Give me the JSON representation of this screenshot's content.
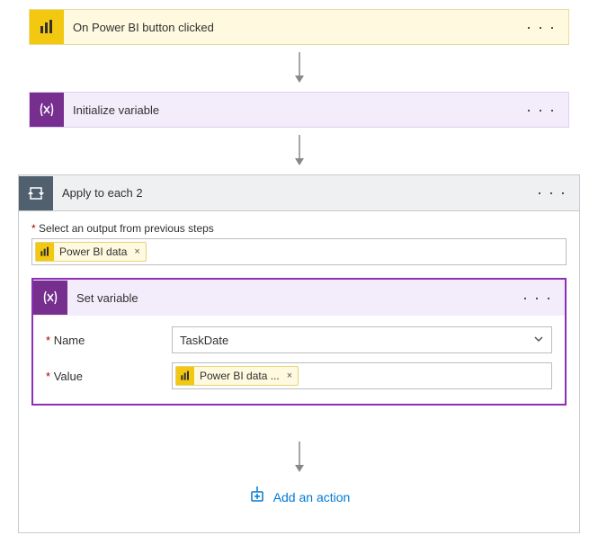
{
  "trigger": {
    "title": "On Power BI button clicked",
    "menu": "· · ·"
  },
  "initVar": {
    "title": "Initialize variable",
    "menu": "· · ·"
  },
  "foreach": {
    "title": "Apply to each 2",
    "menu": "· · ·",
    "selectLabel": "Select an output from previous steps",
    "token": {
      "label": "Power BI data",
      "close": "×"
    }
  },
  "setVar": {
    "title": "Set variable",
    "menu": "· · ·",
    "nameLabel": "Name",
    "nameValue": "TaskDate",
    "valueLabel": "Value",
    "valueToken": {
      "label": "Power BI data ...",
      "close": "×"
    }
  },
  "addAction": "Add an action",
  "asterisk": "*"
}
